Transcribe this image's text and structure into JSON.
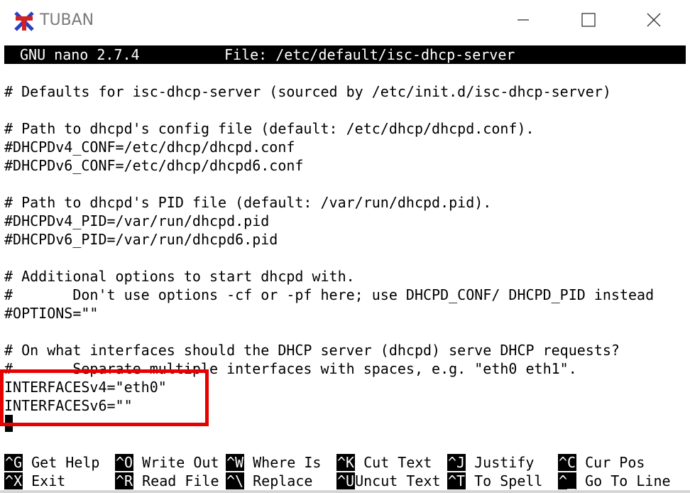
{
  "window": {
    "title": "TUBAN",
    "buttons": [
      "minimize",
      "maximize",
      "close"
    ]
  },
  "nano": {
    "header_left": "GNU nano 2.7.4",
    "header_file": "File: /etc/default/isc-dhcp-server",
    "lines": [
      "# Defaults for isc-dhcp-server (sourced by /etc/init.d/isc-dhcp-server)",
      "",
      "# Path to dhcpd's config file (default: /etc/dhcp/dhcpd.conf).",
      "#DHCPDv4_CONF=/etc/dhcp/dhcpd.conf",
      "#DHCPDv6_CONF=/etc/dhcp/dhcpd6.conf",
      "",
      "# Path to dhcpd's PID file (default: /var/run/dhcpd.pid).",
      "#DHCPDv4_PID=/var/run/dhcpd.pid",
      "#DHCPDv6_PID=/var/run/dhcpd6.pid",
      "",
      "# Additional options to start dhcpd with.",
      "#       Don't use options -cf or -pf here; use DHCPD_CONF/ DHCPD_PID instead",
      "#OPTIONS=\"\"",
      "",
      "# On what interfaces should the DHCP server (dhcpd) serve DHCP requests?",
      "#       Separate multiple interfaces with spaces, e.g. \"eth0 eth1\".",
      "INTERFACESv4=\"eth0\"",
      "INTERFACESv6=\"\""
    ],
    "shortcuts_row1": [
      {
        "key": "^G",
        "label": "Get Help"
      },
      {
        "key": "^O",
        "label": "Write Out"
      },
      {
        "key": "^W",
        "label": "Where Is"
      },
      {
        "key": "^K",
        "label": "Cut Text"
      },
      {
        "key": "^J",
        "label": "Justify"
      },
      {
        "key": "^C",
        "label": "Cur Pos"
      }
    ],
    "shortcuts_row2": [
      {
        "key": "^X",
        "label": "Exit"
      },
      {
        "key": "^R",
        "label": "Read File"
      },
      {
        "key": "^\\",
        "label": "Replace"
      },
      {
        "key": "^U",
        "label": "Uncut Text"
      },
      {
        "key": "^T",
        "label": "To Spell"
      },
      {
        "key": "^_",
        "label": "Go To Line"
      }
    ]
  },
  "annotation": {
    "highlight_color": "#e60000"
  }
}
